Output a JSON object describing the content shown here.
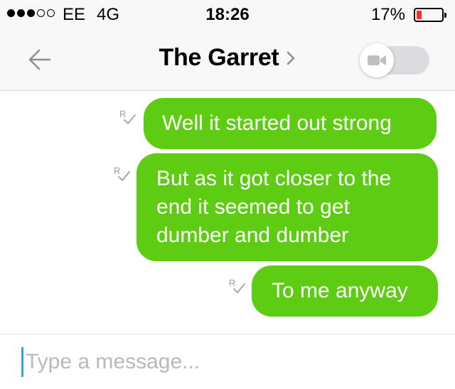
{
  "status_bar": {
    "carrier": "EE",
    "network": "4G",
    "time": "18:26",
    "battery": "17%",
    "battery_level": 0.17,
    "signal_bars": 3
  },
  "nav": {
    "title": "The Garret",
    "icons": [
      "back-arrow-icon",
      "chevron-right-icon",
      "video-camera-icon"
    ]
  },
  "messages": [
    {
      "text": "Well it started out strong",
      "status_icon": "read-receipt-icon"
    },
    {
      "text": "But as it got closer to the end it seemed to get dumber and dumber",
      "status_icon": "read-receipt-icon"
    },
    {
      "text": "To me anyway",
      "status_icon": "read-receipt-icon"
    }
  ],
  "composer": {
    "placeholder": "Type a message..."
  },
  "colors": {
    "bubble": "#5fcc14",
    "bubble_text": "#ffffff",
    "caret": "#2aa9e0",
    "battery_low": "#ff2d2d"
  }
}
